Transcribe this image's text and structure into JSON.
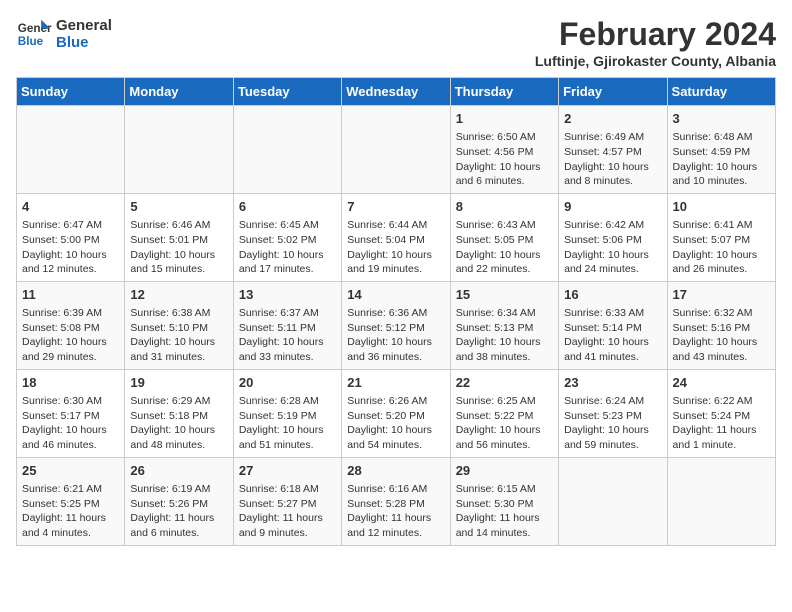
{
  "logo": {
    "line1": "General",
    "line2": "Blue"
  },
  "title": "February 2024",
  "subtitle": "Luftinje, Gjirokaster County, Albania",
  "days_of_week": [
    "Sunday",
    "Monday",
    "Tuesday",
    "Wednesday",
    "Thursday",
    "Friday",
    "Saturday"
  ],
  "weeks": [
    [
      {
        "day": "",
        "info": ""
      },
      {
        "day": "",
        "info": ""
      },
      {
        "day": "",
        "info": ""
      },
      {
        "day": "",
        "info": ""
      },
      {
        "day": "1",
        "info": "Sunrise: 6:50 AM\nSunset: 4:56 PM\nDaylight: 10 hours\nand 6 minutes."
      },
      {
        "day": "2",
        "info": "Sunrise: 6:49 AM\nSunset: 4:57 PM\nDaylight: 10 hours\nand 8 minutes."
      },
      {
        "day": "3",
        "info": "Sunrise: 6:48 AM\nSunset: 4:59 PM\nDaylight: 10 hours\nand 10 minutes."
      }
    ],
    [
      {
        "day": "4",
        "info": "Sunrise: 6:47 AM\nSunset: 5:00 PM\nDaylight: 10 hours\nand 12 minutes."
      },
      {
        "day": "5",
        "info": "Sunrise: 6:46 AM\nSunset: 5:01 PM\nDaylight: 10 hours\nand 15 minutes."
      },
      {
        "day": "6",
        "info": "Sunrise: 6:45 AM\nSunset: 5:02 PM\nDaylight: 10 hours\nand 17 minutes."
      },
      {
        "day": "7",
        "info": "Sunrise: 6:44 AM\nSunset: 5:04 PM\nDaylight: 10 hours\nand 19 minutes."
      },
      {
        "day": "8",
        "info": "Sunrise: 6:43 AM\nSunset: 5:05 PM\nDaylight: 10 hours\nand 22 minutes."
      },
      {
        "day": "9",
        "info": "Sunrise: 6:42 AM\nSunset: 5:06 PM\nDaylight: 10 hours\nand 24 minutes."
      },
      {
        "day": "10",
        "info": "Sunrise: 6:41 AM\nSunset: 5:07 PM\nDaylight: 10 hours\nand 26 minutes."
      }
    ],
    [
      {
        "day": "11",
        "info": "Sunrise: 6:39 AM\nSunset: 5:08 PM\nDaylight: 10 hours\nand 29 minutes."
      },
      {
        "day": "12",
        "info": "Sunrise: 6:38 AM\nSunset: 5:10 PM\nDaylight: 10 hours\nand 31 minutes."
      },
      {
        "day": "13",
        "info": "Sunrise: 6:37 AM\nSunset: 5:11 PM\nDaylight: 10 hours\nand 33 minutes."
      },
      {
        "day": "14",
        "info": "Sunrise: 6:36 AM\nSunset: 5:12 PM\nDaylight: 10 hours\nand 36 minutes."
      },
      {
        "day": "15",
        "info": "Sunrise: 6:34 AM\nSunset: 5:13 PM\nDaylight: 10 hours\nand 38 minutes."
      },
      {
        "day": "16",
        "info": "Sunrise: 6:33 AM\nSunset: 5:14 PM\nDaylight: 10 hours\nand 41 minutes."
      },
      {
        "day": "17",
        "info": "Sunrise: 6:32 AM\nSunset: 5:16 PM\nDaylight: 10 hours\nand 43 minutes."
      }
    ],
    [
      {
        "day": "18",
        "info": "Sunrise: 6:30 AM\nSunset: 5:17 PM\nDaylight: 10 hours\nand 46 minutes."
      },
      {
        "day": "19",
        "info": "Sunrise: 6:29 AM\nSunset: 5:18 PM\nDaylight: 10 hours\nand 48 minutes."
      },
      {
        "day": "20",
        "info": "Sunrise: 6:28 AM\nSunset: 5:19 PM\nDaylight: 10 hours\nand 51 minutes."
      },
      {
        "day": "21",
        "info": "Sunrise: 6:26 AM\nSunset: 5:20 PM\nDaylight: 10 hours\nand 54 minutes."
      },
      {
        "day": "22",
        "info": "Sunrise: 6:25 AM\nSunset: 5:22 PM\nDaylight: 10 hours\nand 56 minutes."
      },
      {
        "day": "23",
        "info": "Sunrise: 6:24 AM\nSunset: 5:23 PM\nDaylight: 10 hours\nand 59 minutes."
      },
      {
        "day": "24",
        "info": "Sunrise: 6:22 AM\nSunset: 5:24 PM\nDaylight: 11 hours\nand 1 minute."
      }
    ],
    [
      {
        "day": "25",
        "info": "Sunrise: 6:21 AM\nSunset: 5:25 PM\nDaylight: 11 hours\nand 4 minutes."
      },
      {
        "day": "26",
        "info": "Sunrise: 6:19 AM\nSunset: 5:26 PM\nDaylight: 11 hours\nand 6 minutes."
      },
      {
        "day": "27",
        "info": "Sunrise: 6:18 AM\nSunset: 5:27 PM\nDaylight: 11 hours\nand 9 minutes."
      },
      {
        "day": "28",
        "info": "Sunrise: 6:16 AM\nSunset: 5:28 PM\nDaylight: 11 hours\nand 12 minutes."
      },
      {
        "day": "29",
        "info": "Sunrise: 6:15 AM\nSunset: 5:30 PM\nDaylight: 11 hours\nand 14 minutes."
      },
      {
        "day": "",
        "info": ""
      },
      {
        "day": "",
        "info": ""
      }
    ]
  ]
}
